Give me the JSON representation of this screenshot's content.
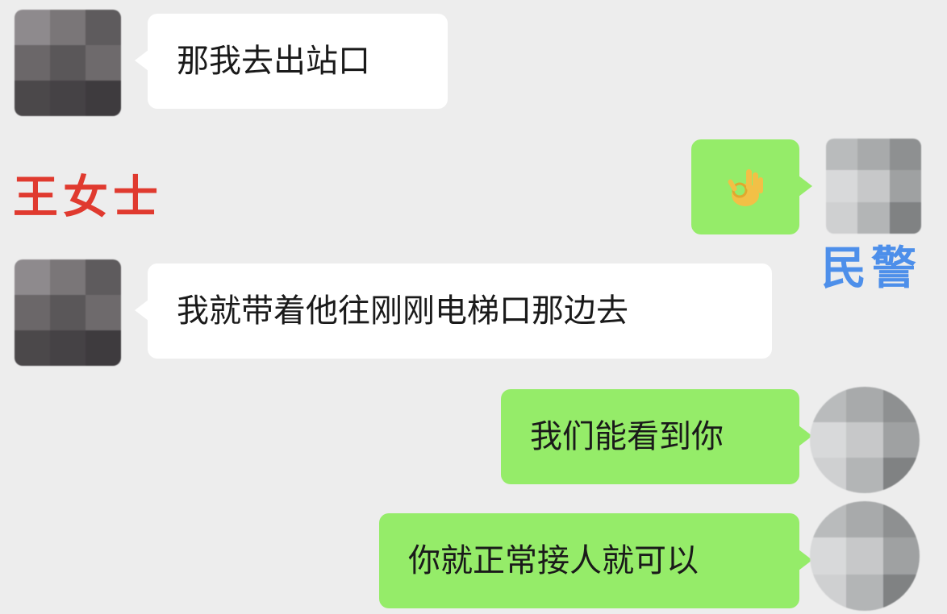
{
  "labels": {
    "left_speaker": "王女士",
    "right_speaker": "民警"
  },
  "colors": {
    "left_label": "#e03a2f",
    "right_label": "#4d8fea",
    "left_bubble": "#ffffff",
    "right_bubble": "#95ec69",
    "background": "#ededed"
  },
  "messages": [
    {
      "side": "left",
      "text": "那我去出站口"
    },
    {
      "side": "right",
      "emoji": "ok-hand-icon"
    },
    {
      "side": "left",
      "text": "我就带着他往刚刚电梯口那边去"
    },
    {
      "side": "right",
      "text": "我们能看到你"
    },
    {
      "side": "right",
      "text": "你就正常接人就可以"
    }
  ]
}
